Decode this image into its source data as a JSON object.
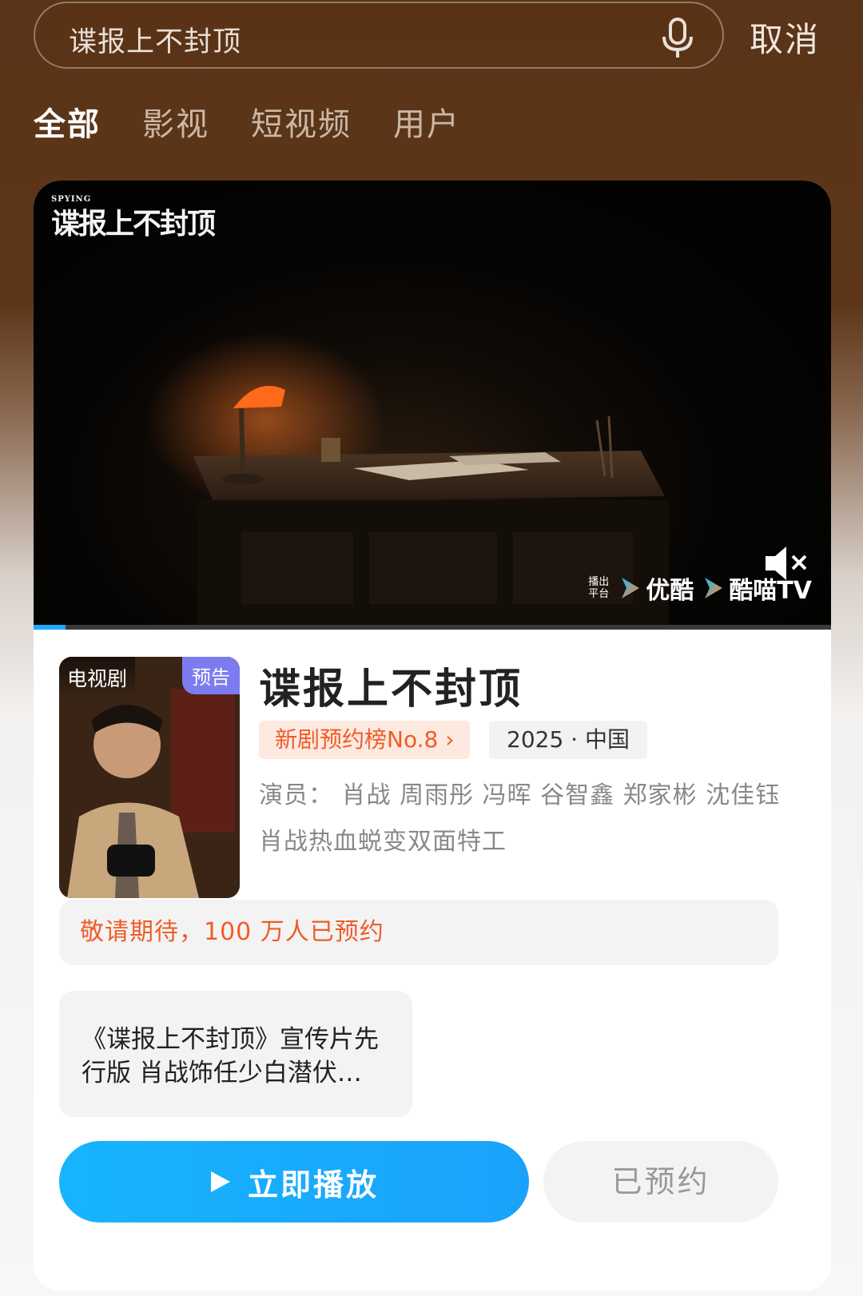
{
  "search": {
    "query": "谍报上不封顶",
    "cancel_label": "取消"
  },
  "tabs": [
    {
      "label": "全部",
      "active": true
    },
    {
      "label": "影视",
      "active": false
    },
    {
      "label": "短视频",
      "active": false
    },
    {
      "label": "用户",
      "active": false
    }
  ],
  "video": {
    "logo_en": "SPYING",
    "logo_cn": "谍报上不封顶",
    "platform_caption": "播出平台",
    "platforms": [
      "优酷",
      "酷喵TV"
    ],
    "progress": 0.04,
    "muted": true
  },
  "show": {
    "poster_type": "电视剧",
    "poster_badge": "预告",
    "title": "谍报上不封顶",
    "rank": "新剧预约榜No.8 ›",
    "meta": "2025 · 中国",
    "cast": "演员： 肖战 周雨彤 冯晖 谷智鑫 郑家彬 沈佳钰",
    "tagline": "肖战热血蜕变双面特工",
    "notice": "敬请期待，100 万人已预约",
    "clip_title": "《谍报上不封顶》宣传片先行版 肖战饰任少白潜伏…"
  },
  "actions": {
    "play_label": "立即播放",
    "reserved_label": "已预约"
  },
  "colors": {
    "accent_blue": "#17b4fd",
    "accent_orange": "#f05c28",
    "badge_purple": "#7c7cf0"
  }
}
